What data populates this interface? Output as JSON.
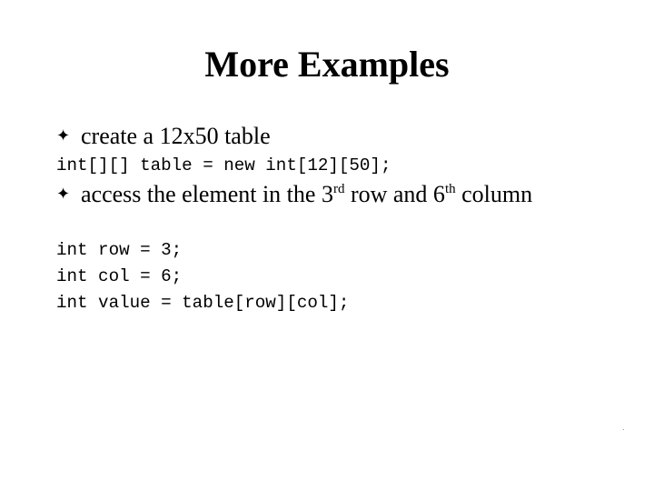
{
  "slide": {
    "title": "More Examples",
    "bullet_glyph": "✦",
    "bullet1": "create a 12x50 table",
    "code1": "int[][] table = new int[12][50];",
    "bullet2": {
      "part1": "access the element in the 3",
      "sup1": "rd",
      "part2": " row and 6",
      "sup2": "th",
      "part3": " column"
    },
    "code_lines": [
      "int row = 3;",
      "int col = 6;",
      "int value = table[row][col];"
    ]
  }
}
